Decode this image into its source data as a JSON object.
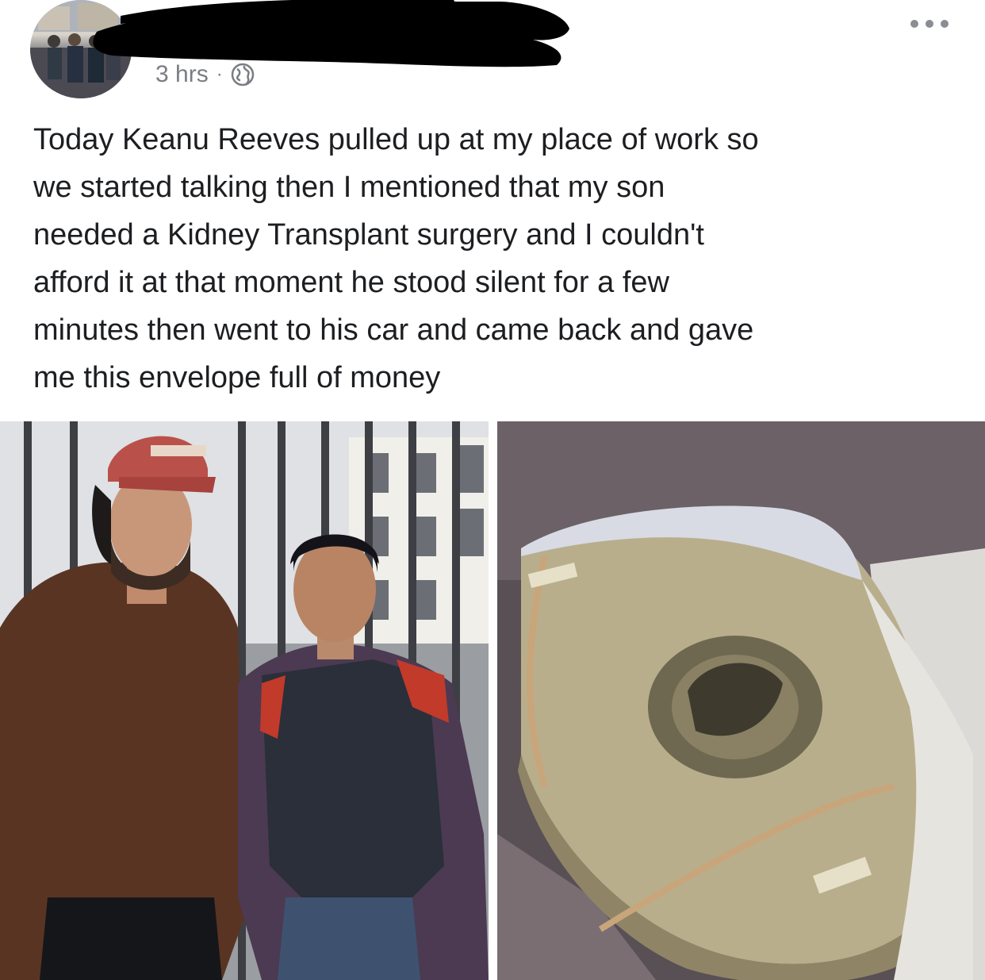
{
  "post": {
    "timestamp": "3 hrs",
    "separator": "·",
    "privacy_icon": "globe-icon",
    "menu_icon": "more-options-icon",
    "text": "Today Keanu Reeves pulled up at my place of work so\nwe started talking then I mentioned that my son\nneeded a Kidney Transplant surgery and I couldn't\nafford it at that moment he stood silent for a few\nminutes then went to his car and came back and gave\nme this envelope full of money",
    "photos": [
      {
        "name": "two-men-photo"
      },
      {
        "name": "money-envelope-photo"
      }
    ]
  },
  "colors": {
    "meta_text": "#7a7d83",
    "body_text": "#1c1e21",
    "redaction": "#000000"
  }
}
